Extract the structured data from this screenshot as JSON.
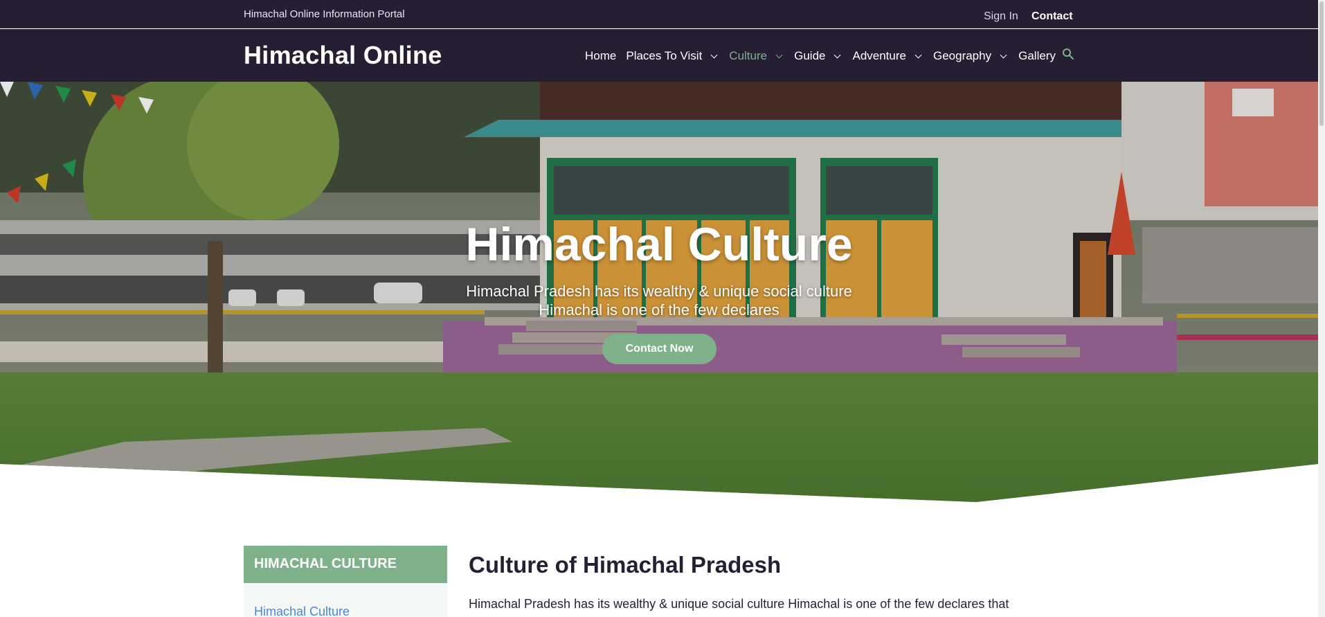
{
  "topbar": {
    "portal_title": "Himachal Online Information Portal",
    "signin_label": "Sign In",
    "contact_label": "Contact"
  },
  "header": {
    "logo_text": "Himachal Online",
    "nav": [
      {
        "label": "Home",
        "has_dropdown": false,
        "active": false
      },
      {
        "label": "Places To Visit",
        "has_dropdown": true,
        "active": false
      },
      {
        "label": "Culture",
        "has_dropdown": true,
        "active": true
      },
      {
        "label": "Guide",
        "has_dropdown": true,
        "active": false
      },
      {
        "label": "Adventure",
        "has_dropdown": true,
        "active": false
      },
      {
        "label": "Geography",
        "has_dropdown": true,
        "active": false
      },
      {
        "label": "Gallery",
        "has_dropdown": false,
        "active": false
      }
    ],
    "search_icon": "search-icon"
  },
  "hero": {
    "title": "Himachal Culture",
    "subtitle_line1": "Himachal Pradesh has its wealthy & unique social culture",
    "subtitle_line2": "Himachal is one of the few declares",
    "cta_label": "Contact Now"
  },
  "sidebar": {
    "heading": "HIMACHAL CULTURE",
    "links": [
      "Himachal Culture"
    ]
  },
  "article": {
    "title": "Culture of Himachal Pradesh",
    "paragraph_start": "Himachal Pradesh has its wealthy & unique social culture Himachal is one of the few declares that"
  },
  "colors": {
    "header_bg": "#261f33",
    "accent": "#7fb28b",
    "link": "#4a86d9",
    "text_dark": "#261f33"
  }
}
